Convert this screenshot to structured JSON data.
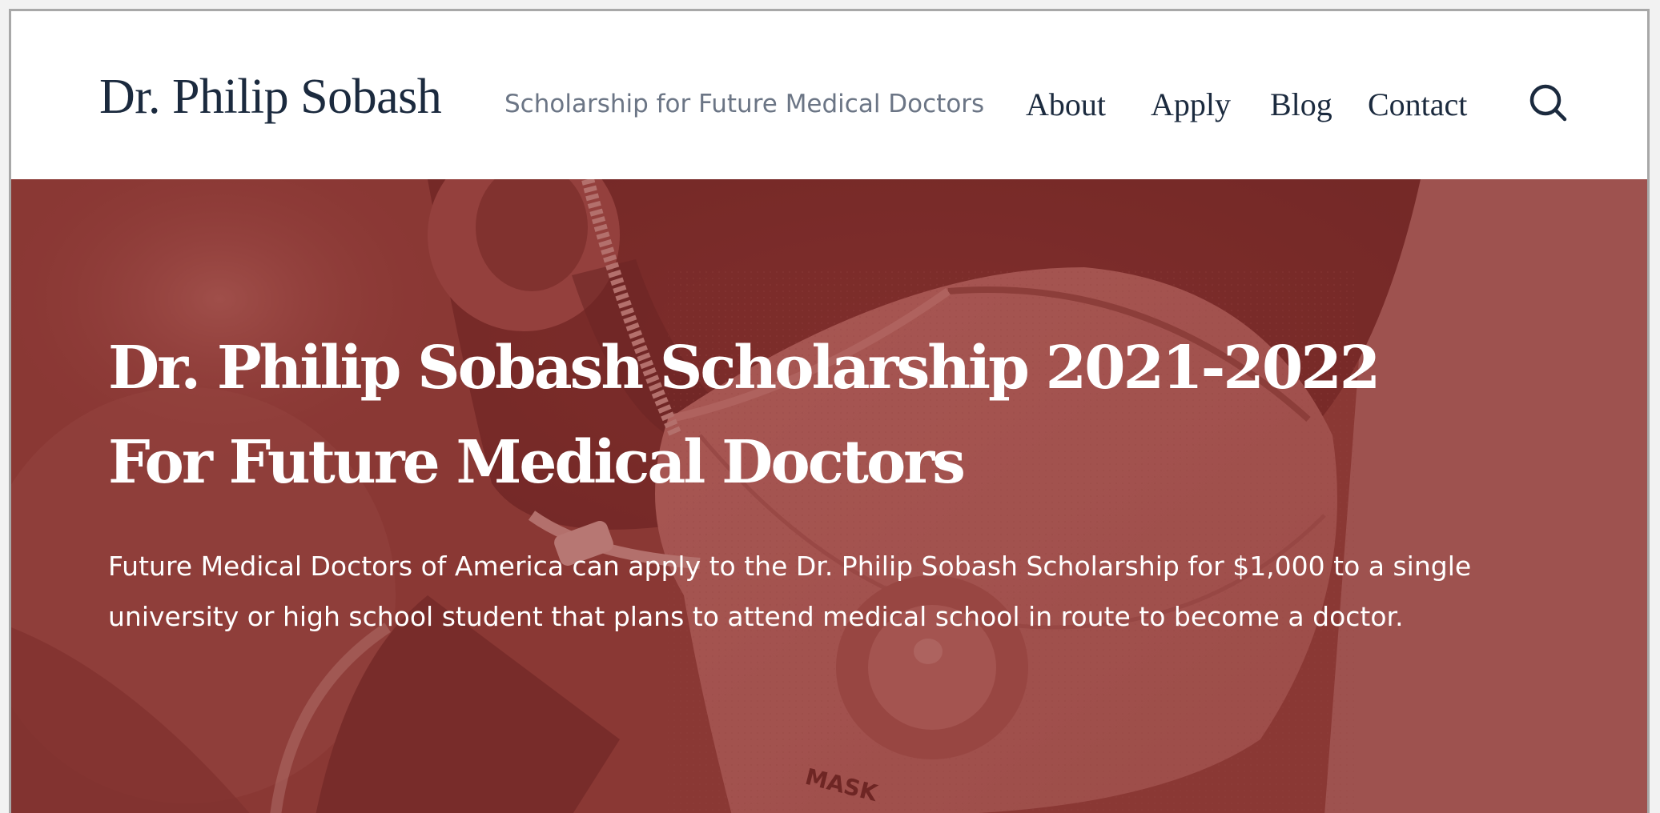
{
  "header": {
    "site_title": "Dr. Philip Sobash",
    "tagline": "Scholarship for Future Medical Doctors",
    "nav": [
      "About",
      "Apply",
      "Blog",
      "Contact"
    ],
    "search_icon": "search-icon"
  },
  "hero": {
    "title_line1": "Dr. Philip Sobash Scholarship 2021-2022",
    "title_line2": "For Future Medical Doctors",
    "description": "Future Medical Doctors of America can apply to the Dr. Philip Sobash Scholarship for $1,000 to a single university or high school student that plans to attend medical school in route to become a doctor.",
    "mask_text": "MASK",
    "overlay_color": "#8a3734"
  },
  "colors": {
    "text_dark": "#1b2a3e",
    "text_muted": "#6b7585",
    "white": "#ffffff"
  }
}
